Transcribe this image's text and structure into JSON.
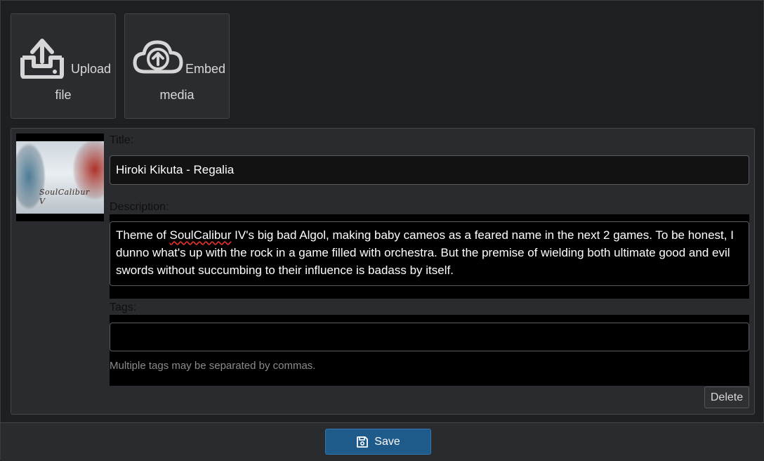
{
  "actions": {
    "upload": {
      "label_line1": "Upload",
      "label_line2": "file",
      "icon": "upload-tray-icon"
    },
    "embed": {
      "label_line1": "Embed",
      "label_line2": "media",
      "icon": "cloud-upload-icon"
    }
  },
  "item": {
    "thumbnail_caption": "SoulCalibur V",
    "title_label": "Title:",
    "title_value": "Hiroki Kikuta - Regalia",
    "description_label": "Description:",
    "description_parts": {
      "before": "Theme of ",
      "misspelled": "SoulCalibur",
      "after": " IV's big bad Algol, making baby cameos as a feared name in the next 2 games. To be honest, I dunno what's up with the rock in a game filled with orchestra. But the premise of wielding both ultimate good and evil swords without succumbing to their influence is badass by itself."
    },
    "tags_label": "Tags:",
    "tags_value": "",
    "tags_help": "Multiple tags may be separated by commas.",
    "delete_label": "Delete"
  },
  "footer": {
    "save_label": "Save",
    "save_icon": "floppy-disk-icon"
  },
  "colors": {
    "save_button": "#1e5a8a",
    "background": "#1e1f22",
    "panel": "#2a2b2e"
  }
}
